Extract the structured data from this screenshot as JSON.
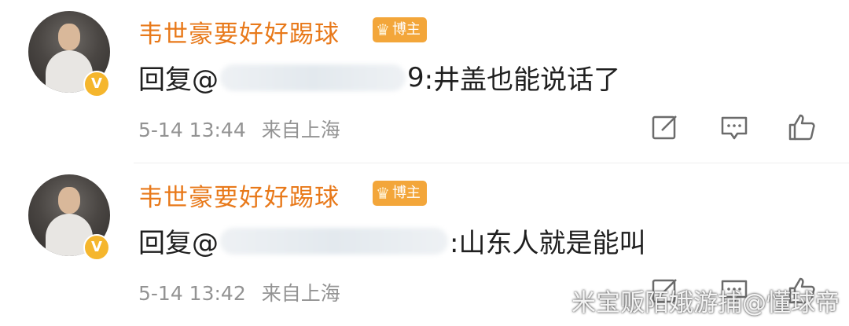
{
  "comments": [
    {
      "username": "韦世豪要好好踢球",
      "badge": "博主",
      "reply_prefix": "回复@",
      "reply_visible_tail": "9",
      "reply_text": ":井盖也能说话了",
      "timestamp": "5-14 13:44",
      "source": "来自上海"
    },
    {
      "username": "韦世豪要好好踢球",
      "badge": "博主",
      "reply_prefix": "回复@",
      "reply_visible_tail": "",
      "reply_text": ":山东人就是能叫",
      "timestamp": "5-14 13:42",
      "source": "来自上海"
    }
  ],
  "watermark": "米宝贩陌娥游捕@懂球帝",
  "icons": {
    "verified": "verified-v-icon",
    "badge": "crown-icon",
    "edit": "edit-icon",
    "comment": "comment-icon",
    "like": "thumbs-up-icon"
  },
  "colors": {
    "username": "#e8791a",
    "badge_bg": "#f3a63a",
    "verified": "#f5b62d",
    "meta": "#939393",
    "text": "#1f1f1f"
  }
}
